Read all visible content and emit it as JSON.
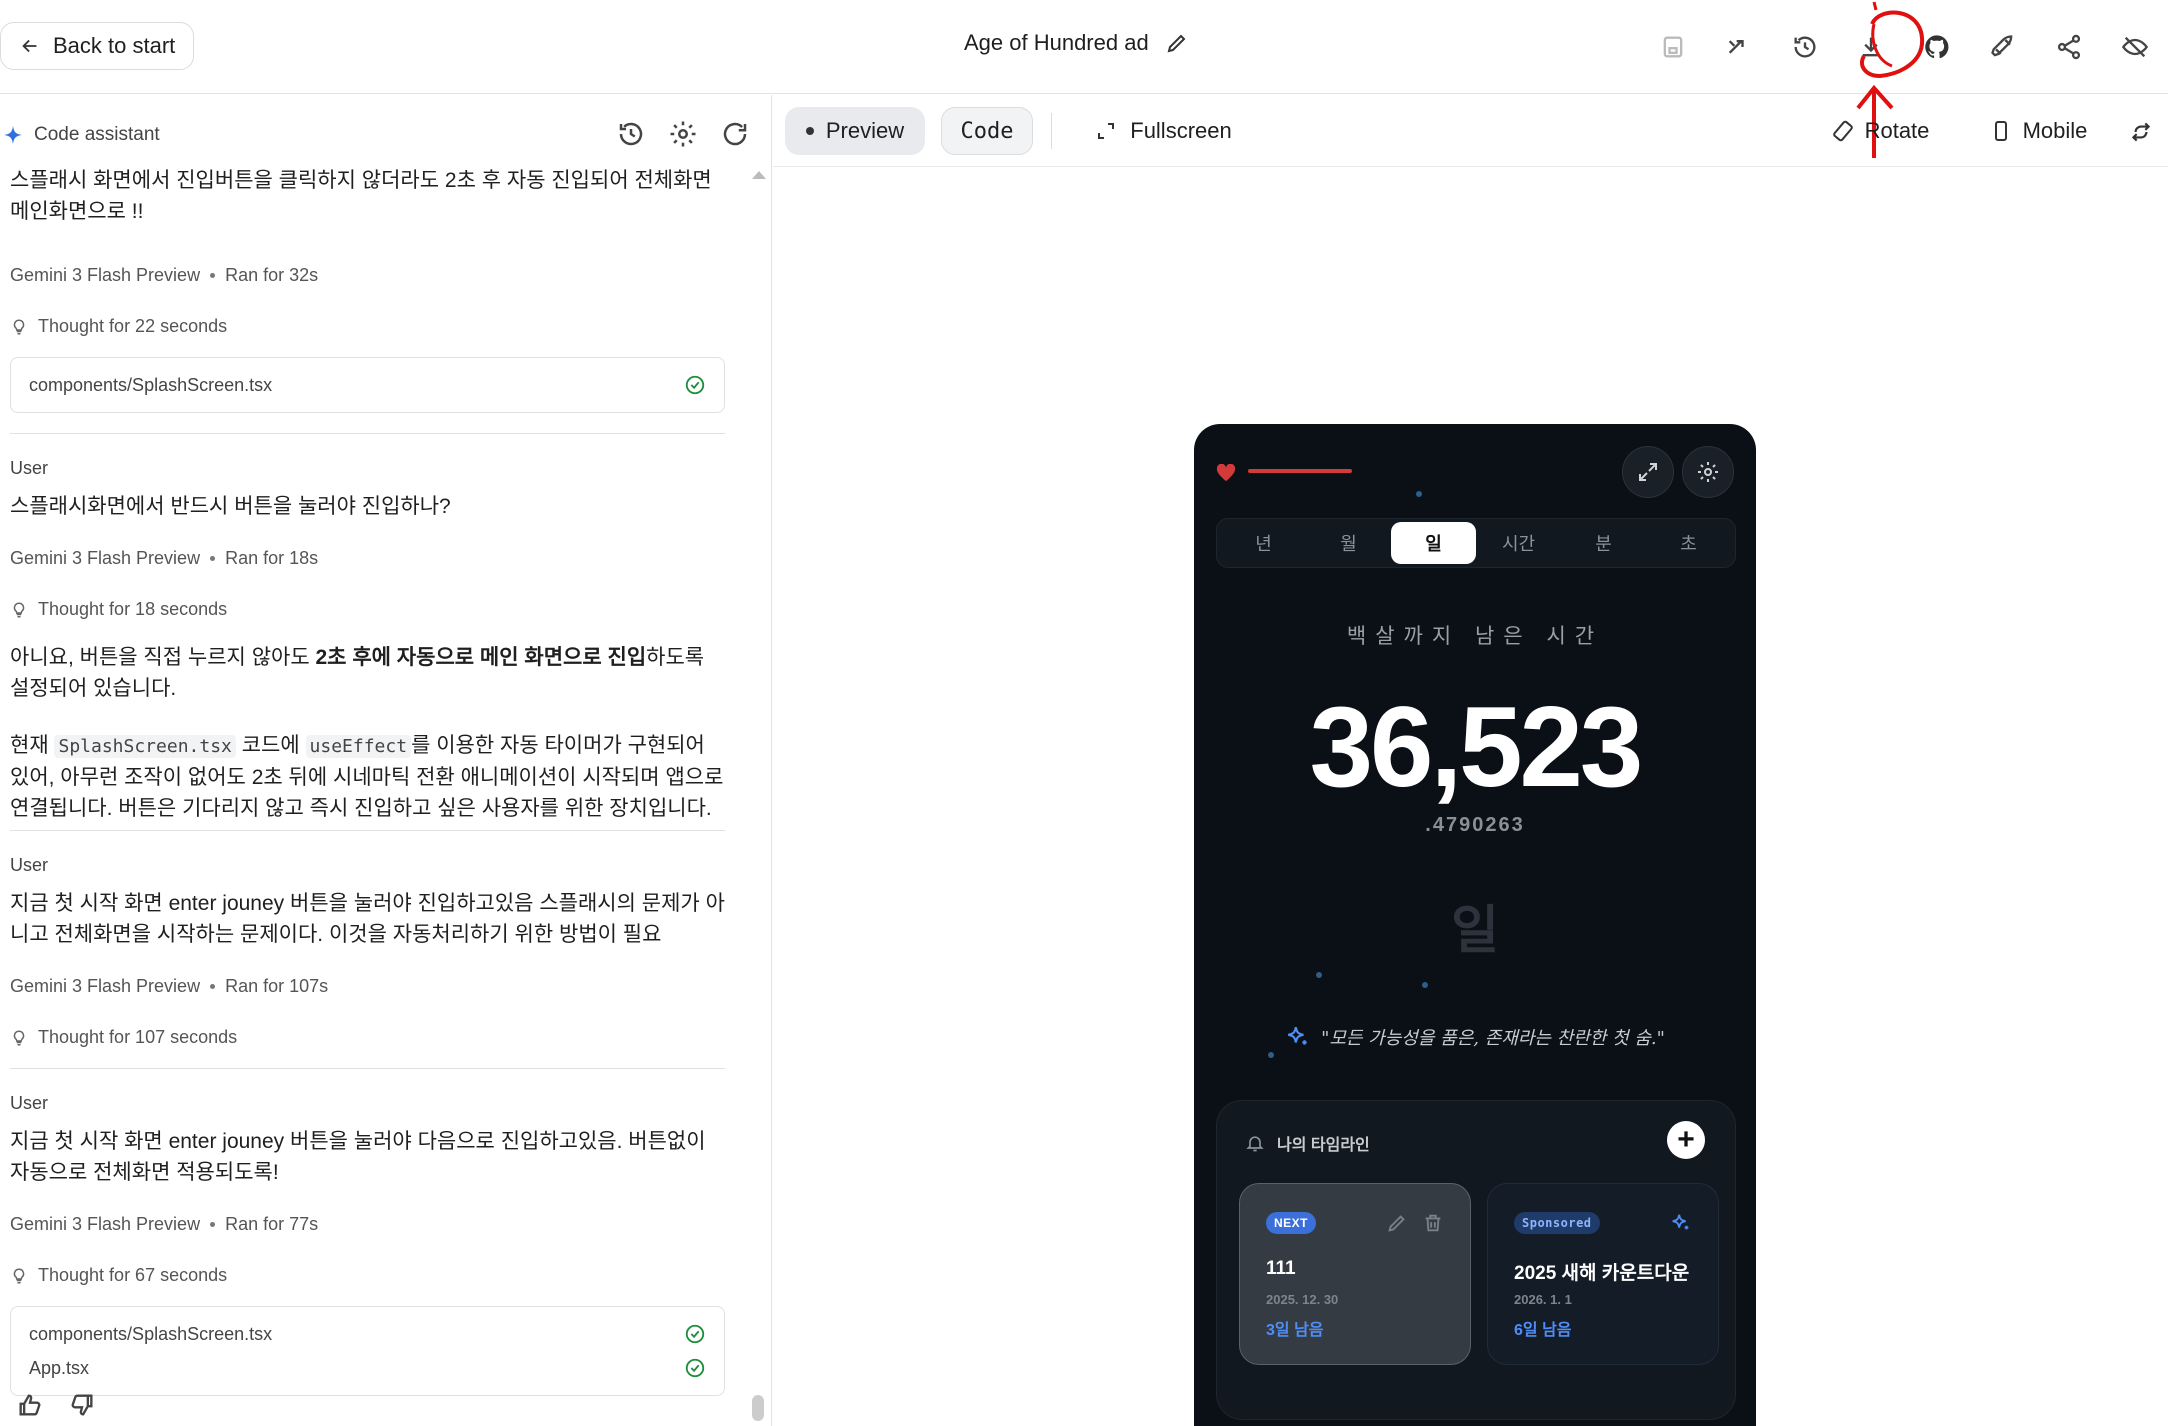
{
  "header": {
    "back_label": "Back to start",
    "project_title": "Age of Hundred ad"
  },
  "assistant": {
    "title": "Code assistant"
  },
  "chat": {
    "msg1_text": "스플래시 화면에서 진입버튼을 클릭하지 않더라도 2초 후 자동 진입되어 전체화면 메인화면으로 !!",
    "msg1_model": "Gemini 3 Flash Preview",
    "msg1_ran": "Ran for 32s",
    "msg1_thought": "Thought for 22 seconds",
    "msg1_file": "components/SplashScreen.tsx",
    "user_label": "User",
    "msg2_text": "스플래시화면에서 반드시 버튼을 눌러야 진입하나?",
    "msg2_model": "Gemini 3 Flash Preview",
    "msg2_ran": "Ran for 18s",
    "msg2_thought": "Thought for 18 seconds",
    "msg2_reply_a": "아니요, 버튼을 직접 누르지 않아도 ",
    "msg2_reply_bold": "2초 후에 자동으로 메인 화면으로 진입",
    "msg2_reply_b": "하도록 설정되어 있습니다.",
    "msg2_reply2_a": "현재 ",
    "msg2_reply2_code1": "SplashScreen.tsx",
    "msg2_reply2_b": " 코드에 ",
    "msg2_reply2_code2": "useEffect",
    "msg2_reply2_c": "를 이용한 자동 타이머가 구현되어 있어, 아무런 조작이 없어도 2초 뒤에 시네마틱 전환 애니메이션이 시작되며 앱으로 연결됩니다. 버튼은 기다리지 않고 즉시 진입하고 싶은 사용자를 위한 장치입니다.",
    "msg3_text": "지금 첫 시작 화면 enter jouney 버튼을 눌러야 진입하고있음 스플래시의 문제가 아니고 전체화면을 시작하는 문제이다. 이것을 자동처리하기 위한 방법이 필요",
    "msg3_model": "Gemini 3 Flash Preview",
    "msg3_ran": "Ran for 107s",
    "msg3_thought": "Thought for 107 seconds",
    "msg4_text": "지금 첫 시작 화면 enter jouney 버튼을 눌러야 다음으로 진입하고있음. 버튼없이 자동으로 전체화면 적용되도록!",
    "msg4_model": "Gemini 3 Flash Preview",
    "msg4_ran": "Ran for 77s",
    "msg4_thought": "Thought for 67 seconds",
    "msg4_file1": "components/SplashScreen.tsx",
    "msg4_file2": "App.tsx"
  },
  "toolbar": {
    "preview": "Preview",
    "code": "Code",
    "fullscreen": "Fullscreen",
    "rotate": "Rotate",
    "mobile": "Mobile"
  },
  "app": {
    "tabs": [
      "년",
      "월",
      "일",
      "시간",
      "분",
      "초"
    ],
    "active_tab_index": 2,
    "remain_label": "백살까지 남은 시간",
    "big_number": "36,523",
    "decimal": ".4790263",
    "unit": "일",
    "quote": "\"모든 가능성을 품은, 존재라는 찬란한 첫 숨.\"",
    "timeline_title": "나의 타임라인",
    "add_symbol": "+",
    "card1": {
      "badge": "NEXT",
      "name": "111",
      "date": "2025. 12. 30",
      "left": "3일 남음"
    },
    "card2": {
      "badge": "Sponsored",
      "name": "2025 새해 카운트다운",
      "date": "2026. 1. 1",
      "left": "6일 남음"
    },
    "accent": "#3b6fd9",
    "danger": "#d33a3a"
  },
  "icons": {
    "top": [
      "save-icon",
      "shuffle-icon",
      "history-icon",
      "download-icon",
      "github-icon",
      "rocket-icon",
      "share-icon",
      "eye-off-icon"
    ]
  }
}
